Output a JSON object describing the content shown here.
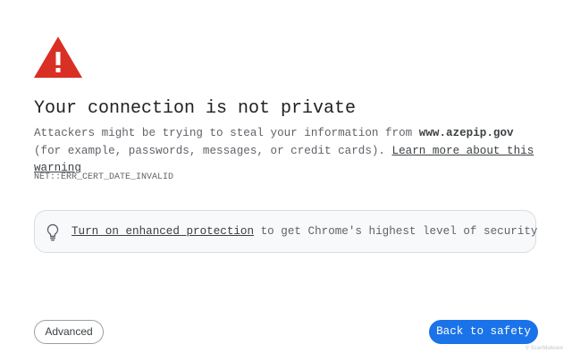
{
  "colors": {
    "warning_red": "#d93025",
    "primary_blue": "#1a73e8",
    "text": "#202124",
    "secondary_text": "#5f6368",
    "box_background": "#f8f9fa"
  },
  "interstitial": {
    "icon": "warning-triangle-icon",
    "title": "Your connection is not private",
    "body_prefix": "Attackers might be trying to steal your information from ",
    "domain": "www.azepip.gov",
    "body_middle": " (for example, passwords, messages, or credit cards). ",
    "learn_more_link": "Learn more about this warning",
    "error_code": "NET::ERR_CERT_DATE_INVALID"
  },
  "enhanced_protection": {
    "icon": "lightbulb-icon",
    "link_text": "Turn on enhanced protection",
    "rest_text": " to get Chrome's highest level of security"
  },
  "buttons": {
    "advanced_label": "Advanced",
    "back_to_safety_label": "Back to safety"
  },
  "watermark": {
    "text": "ScanMalware"
  }
}
